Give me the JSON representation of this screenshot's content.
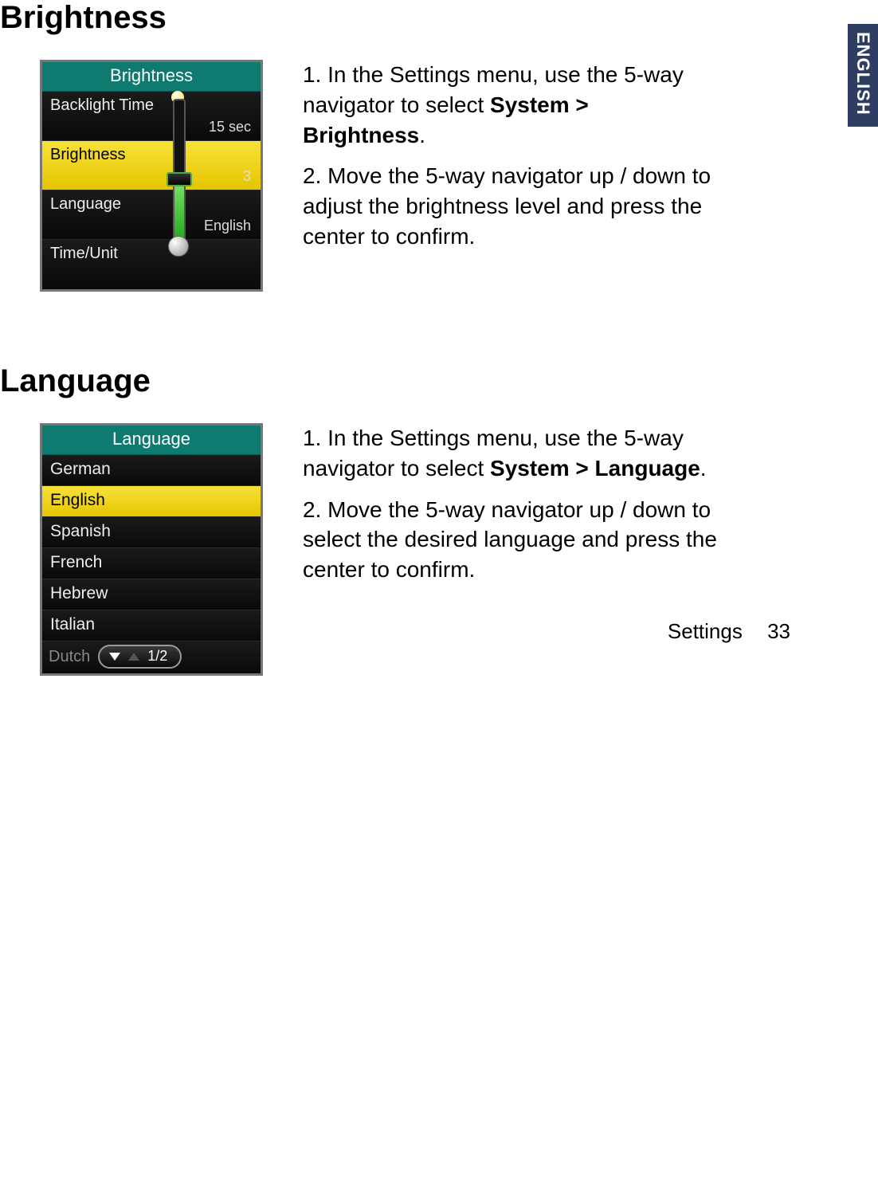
{
  "side_tab": "ENGLISH",
  "footer": {
    "section": "Settings",
    "page": "33"
  },
  "brightness": {
    "heading": "Brightness",
    "screen": {
      "title": "Brightness",
      "rows": [
        {
          "label": "Backlight Time",
          "value": "15 sec"
        },
        {
          "label": "Brightness",
          "value": "3",
          "selected": true
        },
        {
          "label": "Language",
          "value": "English"
        },
        {
          "label": "Time/Unit",
          "value": ""
        }
      ]
    },
    "steps": [
      {
        "num": "1.",
        "pre": "In the Settings menu, use the 5-way navigator to select ",
        "bold": "System > Brightness",
        "post": "."
      },
      {
        "num": "2.",
        "pre": "Move the 5-way navigator up / down to adjust the brightness level and press the center to confirm.",
        "bold": "",
        "post": ""
      }
    ]
  },
  "language": {
    "heading": "Language",
    "screen": {
      "title": "Language",
      "items": [
        "German",
        "English",
        "Spanish",
        "French",
        "Hebrew",
        "Italian"
      ],
      "selected_index": 1,
      "footer_extra": "Dutch",
      "page_indicator": "1/2"
    },
    "steps": [
      {
        "num": "1.",
        "pre": "In the Settings menu, use the 5-way navigator to select ",
        "bold": "System > Language",
        "post": "."
      },
      {
        "num": "2.",
        "pre": "Move the 5-way navigator up / down to select the desired language and press the center to confirm.",
        "bold": "",
        "post": ""
      }
    ]
  }
}
